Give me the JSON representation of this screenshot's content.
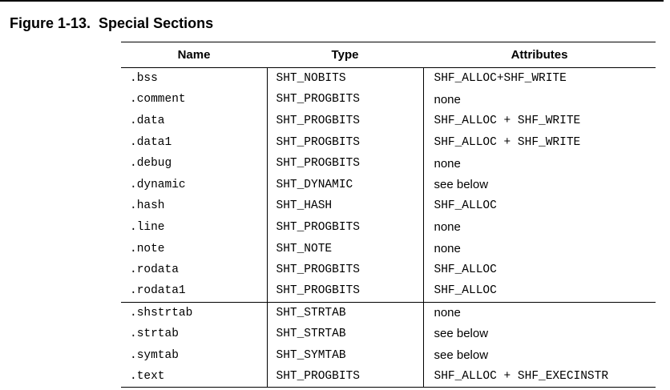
{
  "figure": {
    "title": "Figure 1-13.  Special Sections"
  },
  "table": {
    "headers": {
      "name": "Name",
      "type": "Type",
      "attributes": "Attributes"
    },
    "rows": [
      {
        "name": ".bss",
        "type": "SHT_NOBITS",
        "attributes": "SHF_ALLOC+SHF_WRITE",
        "attributes_font": "mono"
      },
      {
        "name": ".comment",
        "type": "SHT_PROGBITS",
        "attributes": "none",
        "attributes_font": "sans"
      },
      {
        "name": ".data",
        "type": "SHT_PROGBITS",
        "attributes": "SHF_ALLOC + SHF_WRITE",
        "attributes_font": "mono"
      },
      {
        "name": ".data1",
        "type": "SHT_PROGBITS",
        "attributes": "SHF_ALLOC + SHF_WRITE",
        "attributes_font": "mono"
      },
      {
        "name": ".debug",
        "type": "SHT_PROGBITS",
        "attributes": "none",
        "attributes_font": "sans"
      },
      {
        "name": ".dynamic",
        "type": "SHT_DYNAMIC",
        "attributes": "see below",
        "attributes_font": "sans"
      },
      {
        "name": ".hash",
        "type": "SHT_HASH",
        "attributes": "SHF_ALLOC",
        "attributes_font": "mono"
      },
      {
        "name": ".line",
        "type": "SHT_PROGBITS",
        "attributes": "none",
        "attributes_font": "sans"
      },
      {
        "name": ".note",
        "type": "SHT_NOTE",
        "attributes": "none",
        "attributes_font": "sans"
      },
      {
        "name": ".rodata",
        "type": "SHT_PROGBITS",
        "attributes": "SHF_ALLOC",
        "attributes_font": "mono"
      },
      {
        "name": ".rodata1",
        "type": "SHT_PROGBITS",
        "attributes": "SHF_ALLOC",
        "attributes_font": "mono"
      },
      {
        "name": ".shstrtab",
        "type": "SHT_STRTAB",
        "attributes": "none",
        "attributes_font": "sans"
      },
      {
        "name": ".strtab",
        "type": "SHT_STRTAB",
        "attributes": "see below",
        "attributes_font": "sans"
      },
      {
        "name": ".symtab",
        "type": "SHT_SYMTAB",
        "attributes": "see below",
        "attributes_font": "sans"
      },
      {
        "name": ".text",
        "type": "SHT_PROGBITS",
        "attributes": "SHF_ALLOC + SHF_EXECINSTR",
        "attributes_font": "mono"
      }
    ]
  }
}
